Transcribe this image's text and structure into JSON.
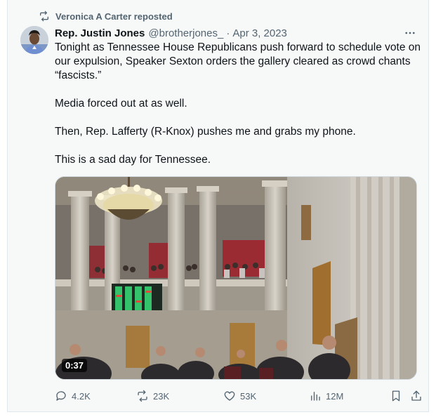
{
  "repost": {
    "label": "Veronica A Carter reposted",
    "icon": "repost-icon"
  },
  "tweet": {
    "author_name": "Rep. Justin Jones",
    "author_handle": "@brotherjones_",
    "separator": "·",
    "date": "Apr 3, 2023",
    "text": "Tonight as Tennessee House Republicans push forward to schedule vote on our expulsion, Speaker Sexton orders the gallery cleared as crowd chants “fascists.”\n\nMedia forced out at as well.\n\nThen, Rep. Lafferty (R-Knox) pushes me and grabs my phone.\n\nThis is a sad day for Tennessee.",
    "video_duration": "0:37"
  },
  "actions": {
    "replies": "4.2K",
    "reposts": "23K",
    "likes": "53K",
    "views": "12M"
  },
  "colors": {
    "secondary_text": "#536471",
    "primary_text": "#0f1419",
    "card_bg": "#f7f9f9"
  }
}
